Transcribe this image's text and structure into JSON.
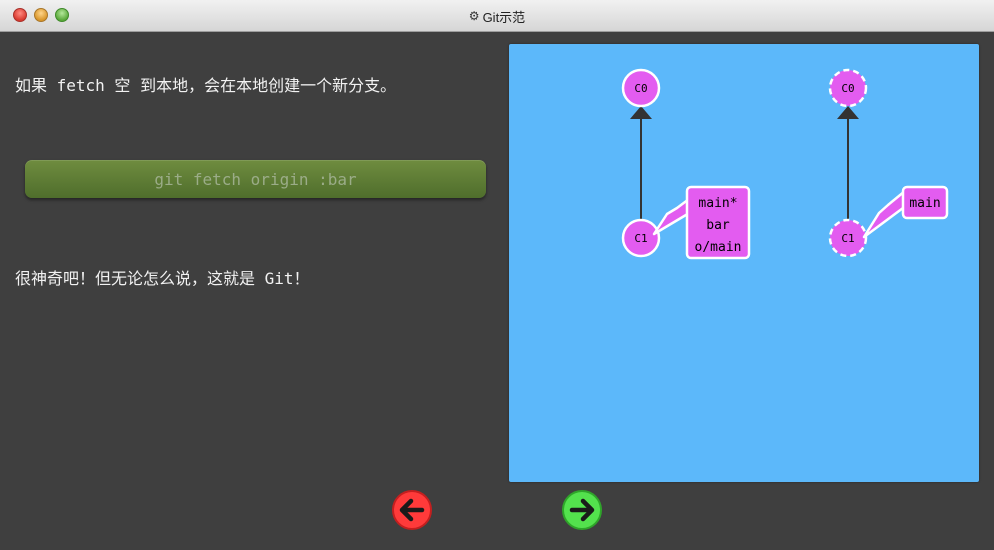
{
  "window": {
    "title": "Git示范",
    "title_icon": "gear-icon"
  },
  "instructions": {
    "paragraph_1": "如果 fetch 空 到本地，会在本地创建一个新分支。",
    "command": "git fetch origin :bar",
    "paragraph_2": "很神奇吧！但无论怎么说，这就是 Git！"
  },
  "visualization": {
    "local_repo": {
      "commits": [
        "C0",
        "C1"
      ],
      "branch_label_lines": [
        "main*",
        "bar",
        "o/main"
      ]
    },
    "remote_repo": {
      "commits": [
        "C0",
        "C1"
      ],
      "branch_label_lines": [
        "main"
      ]
    },
    "colors": {
      "canvas_background": "#5cb8fa",
      "commit_fill": "#e35cf0",
      "branch_fill": "#e35cf0",
      "edge": "#333333"
    }
  },
  "navigation": {
    "back_icon": "arrow-left-icon",
    "forward_icon": "arrow-right-icon",
    "back_color": "#ff3a3a",
    "forward_color": "#53e24d"
  }
}
